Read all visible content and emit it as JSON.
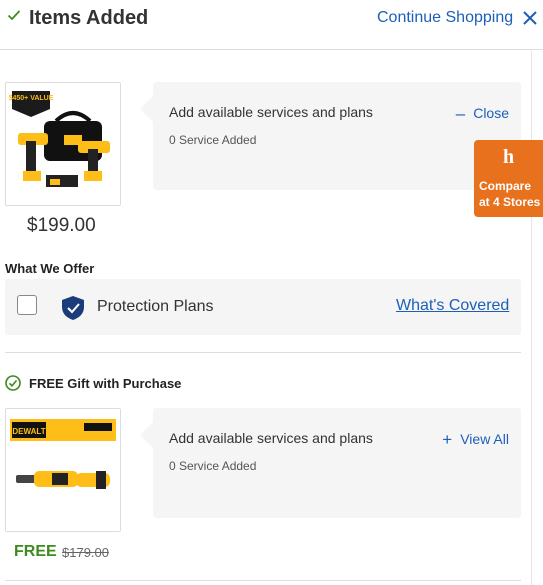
{
  "header": {
    "title": "Items Added",
    "continue_label": "Continue Shopping"
  },
  "item1": {
    "image_badge": "$450+ VALUE",
    "price": "$199.00",
    "services": {
      "title": "Add available services and plans",
      "count": "0 Service Added",
      "toggle_symbol": "–",
      "toggle_label": "Close"
    }
  },
  "compare": {
    "logo": "h",
    "line1": "Compare",
    "line2": "at 4 Stores"
  },
  "offer": {
    "heading": "What We Offer",
    "plan_label": "Protection Plans",
    "link_label": "What's Covered",
    "checked": false
  },
  "gift": {
    "heading": "FREE Gift with Purchase",
    "image_brand": "DEWALT",
    "free_label": "FREE",
    "was_price": "$179.00",
    "services": {
      "title": "Add available services and plans",
      "count": "0 Service Added",
      "toggle_symbol": "+",
      "toggle_label": "View All"
    }
  },
  "colors": {
    "link": "#1d5fb8",
    "accent_orange": "#e8711e",
    "free_green": "#3d8b1f",
    "shield_navy": "#1a3c7a",
    "dewalt_yellow": "#febd17"
  }
}
